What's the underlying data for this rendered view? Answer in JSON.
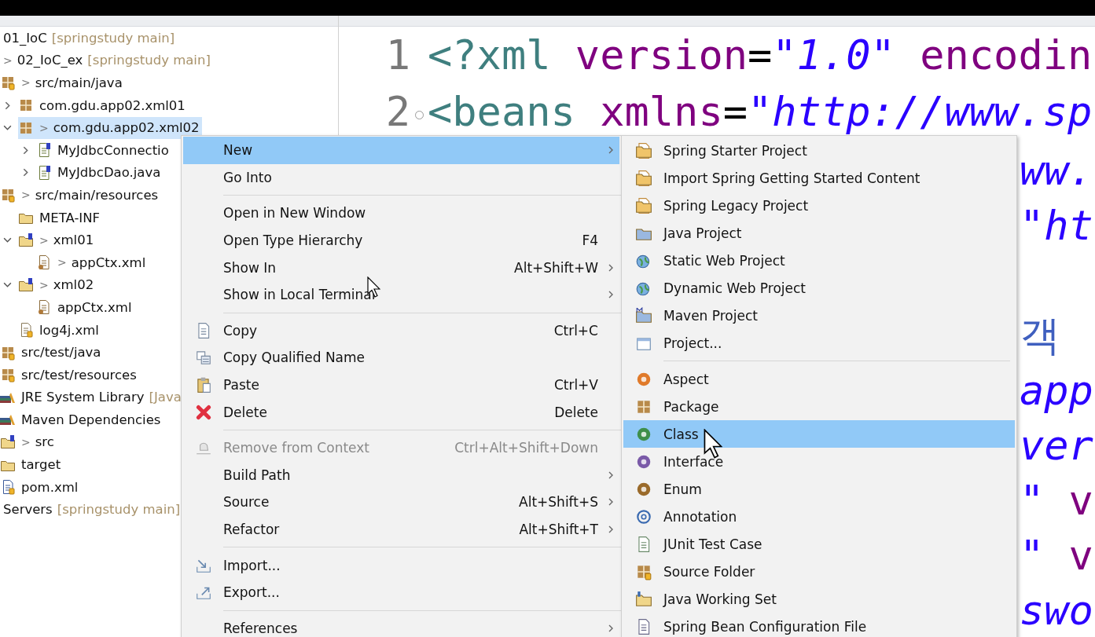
{
  "tree": {
    "items": [
      {
        "label": "01_IoC",
        "suffix": "[springstudy main]",
        "selected": false
      },
      {
        "decoration": ">",
        "label": "02_IoC_ex",
        "suffix": "[springstudy main]",
        "selected": false,
        "children": [
          {
            "decoration": ">",
            "label": "src/main/java",
            "kind": "source-folder",
            "selected": false,
            "children": [
              {
                "label": "com.gdu.app02.xml01",
                "kind": "package",
                "expanded": false,
                "selected": false
              },
              {
                "decoration": ">",
                "label": "com.gdu.app02.xml02",
                "kind": "package",
                "expanded": true,
                "selected": true,
                "children": [
                  {
                    "label": "MyJdbcConnectio",
                    "kind": "java-file",
                    "expanded": false,
                    "selected": false
                  },
                  {
                    "label": "MyJdbcDao.java",
                    "kind": "java-file",
                    "expanded": false,
                    "selected": false
                  }
                ]
              }
            ]
          },
          {
            "decoration": ">",
            "label": "src/main/resources",
            "kind": "source-folder",
            "selected": false,
            "children": [
              {
                "label": "META-INF",
                "kind": "folder",
                "selected": false
              },
              {
                "decoration": ">",
                "label": "xml01",
                "kind": "spring-folder",
                "expanded": true,
                "selected": false,
                "children": [
                  {
                    "decoration": ">",
                    "label": "appCtx.xml",
                    "kind": "bean-file",
                    "selected": false
                  }
                ]
              },
              {
                "decoration": ">",
                "label": "xml02",
                "kind": "spring-folder",
                "expanded": true,
                "selected": false,
                "children": [
                  {
                    "label": "appCtx.xml",
                    "kind": "bean-file",
                    "selected": false
                  }
                ]
              },
              {
                "label": "log4j.xml",
                "kind": "xml-file",
                "selected": false
              }
            ]
          },
          {
            "label": "src/test/java",
            "kind": "source-folder",
            "selected": false
          },
          {
            "label": "src/test/resources",
            "kind": "source-folder",
            "selected": false
          },
          {
            "label": "JRE System Library",
            "suffix": "[Java",
            "kind": "library",
            "selected": false
          },
          {
            "label": "Maven Dependencies",
            "kind": "library",
            "selected": false
          },
          {
            "decoration": ">",
            "label": "src",
            "kind": "spring-folder",
            "selected": false
          },
          {
            "label": "target",
            "kind": "folder",
            "selected": false
          },
          {
            "label": "pom.xml",
            "kind": "maven-file",
            "selected": false
          }
        ]
      },
      {
        "label": "Servers",
        "suffix": "[springstudy main]",
        "selected": false
      }
    ]
  },
  "editor": {
    "lines": [
      {
        "number": "1",
        "foldable": false,
        "segments": [
          {
            "kind": "tag",
            "text": "<?xml"
          },
          {
            "kind": "attr",
            "text": " version"
          },
          {
            "kind": "op",
            "text": "="
          },
          {
            "kind": "value",
            "text": "\"1.0\""
          },
          {
            "kind": "attr",
            "text": " encodin"
          }
        ]
      },
      {
        "number": "2",
        "foldable": true,
        "segments": [
          {
            "kind": "tag",
            "text": "<beans"
          },
          {
            "kind": "attr",
            "text": " xmlns"
          },
          {
            "kind": "op",
            "text": "="
          },
          {
            "kind": "value",
            "text": "\"http://www.sp"
          }
        ]
      }
    ],
    "fragments": [
      {
        "segments": [
          {
            "kind": "value",
            "text": "ww."
          }
        ]
      },
      {
        "segments": [
          {
            "kind": "value",
            "text": "\"ht"
          }
        ]
      },
      {
        "gap_before": true,
        "segments": [
          {
            "kind": "comment",
            "text": "객"
          }
        ]
      },
      {
        "segments": [
          {
            "kind": "value",
            "text": "app"
          }
        ]
      },
      {
        "segments": [
          {
            "kind": "value",
            "text": "ver"
          }
        ]
      },
      {
        "segments": [
          {
            "kind": "value",
            "text": "\""
          },
          {
            "kind": "attr",
            "text": " v"
          }
        ]
      },
      {
        "segments": [
          {
            "kind": "value",
            "text": "\""
          },
          {
            "kind": "attr",
            "text": " v"
          }
        ]
      },
      {
        "segments": [
          {
            "kind": "value",
            "text": "swo"
          }
        ]
      }
    ]
  },
  "context_menu": {
    "items": [
      {
        "kind": "plain",
        "label": "New",
        "submenu": true,
        "selected": true,
        "disabled": false
      },
      {
        "kind": "plain",
        "label": "Go Into",
        "submenu": false,
        "selected": false,
        "disabled": false
      },
      {
        "kind": "separator"
      },
      {
        "kind": "plain",
        "label": "Open in New Window",
        "submenu": false,
        "selected": false,
        "disabled": false
      },
      {
        "kind": "plain",
        "label": "Open Type Hierarchy",
        "shortcut": "F4",
        "submenu": false,
        "selected": false,
        "disabled": false
      },
      {
        "kind": "plain",
        "label": "Show In",
        "shortcut": "Alt+Shift+W",
        "submenu": true,
        "selected": false,
        "disabled": false
      },
      {
        "kind": "plain",
        "label": "Show in Local Terminal",
        "submenu": true,
        "selected": false,
        "disabled": false
      },
      {
        "kind": "separator"
      },
      {
        "kind": "copy",
        "label": "Copy",
        "shortcut": "Ctrl+C",
        "submenu": false,
        "selected": false,
        "disabled": false
      },
      {
        "kind": "copy-name",
        "label": "Copy Qualified Name",
        "submenu": false,
        "selected": false,
        "disabled": false
      },
      {
        "kind": "paste",
        "label": "Paste",
        "shortcut": "Ctrl+V",
        "submenu": false,
        "selected": false,
        "disabled": false
      },
      {
        "kind": "delete",
        "label": "Delete",
        "shortcut": "Delete",
        "submenu": false,
        "selected": false,
        "disabled": false
      },
      {
        "kind": "separator"
      },
      {
        "kind": "remove",
        "label": "Remove from Context",
        "shortcut": "Ctrl+Alt+Shift+Down",
        "submenu": false,
        "selected": false,
        "disabled": true
      },
      {
        "kind": "plain",
        "label": "Build Path",
        "submenu": true,
        "selected": false,
        "disabled": false
      },
      {
        "kind": "plain",
        "label": "Source",
        "shortcut": "Alt+Shift+S",
        "submenu": true,
        "selected": false,
        "disabled": false
      },
      {
        "kind": "plain",
        "label": "Refactor",
        "shortcut": "Alt+Shift+T",
        "submenu": true,
        "selected": false,
        "disabled": false
      },
      {
        "kind": "separator"
      },
      {
        "kind": "import",
        "label": "Import...",
        "submenu": false,
        "selected": false,
        "disabled": false
      },
      {
        "kind": "export",
        "label": "Export...",
        "submenu": false,
        "selected": false,
        "disabled": false
      },
      {
        "kind": "separator"
      },
      {
        "kind": "plain",
        "label": "References",
        "submenu": true,
        "selected": false,
        "disabled": false
      }
    ]
  },
  "new_submenu": {
    "items": [
      {
        "kind": "spring-project",
        "label": "Spring Starter Project",
        "selected": false
      },
      {
        "kind": "spring-project",
        "label": "Import Spring Getting Started Content",
        "selected": false
      },
      {
        "kind": "spring-project",
        "label": "Spring Legacy Project",
        "selected": false
      },
      {
        "kind": "java-project",
        "label": "Java Project",
        "selected": false
      },
      {
        "kind": "web-project",
        "label": "Static Web Project",
        "selected": false
      },
      {
        "kind": "web-project",
        "label": "Dynamic Web Project",
        "selected": false
      },
      {
        "kind": "maven-project",
        "label": "Maven Project",
        "selected": false
      },
      {
        "kind": "project",
        "label": "Project...",
        "selected": false
      },
      {
        "kind": "separator"
      },
      {
        "kind": "aspect",
        "label": "Aspect",
        "selected": false
      },
      {
        "kind": "package-new",
        "label": "Package",
        "selected": false
      },
      {
        "kind": "class",
        "label": "Class",
        "selected": true
      },
      {
        "kind": "interface",
        "label": "Interface",
        "selected": false
      },
      {
        "kind": "enum",
        "label": "Enum",
        "selected": false
      },
      {
        "kind": "annotation",
        "label": "Annotation",
        "selected": false
      },
      {
        "kind": "junit",
        "label": "JUnit Test Case",
        "selected": false
      },
      {
        "kind": "source-folder",
        "label": "Source Folder",
        "selected": false
      },
      {
        "kind": "working-set",
        "label": "Java Working Set",
        "selected": false
      },
      {
        "kind": "bean-file-new",
        "label": "Spring Bean Configuration File",
        "selected": false
      }
    ]
  }
}
